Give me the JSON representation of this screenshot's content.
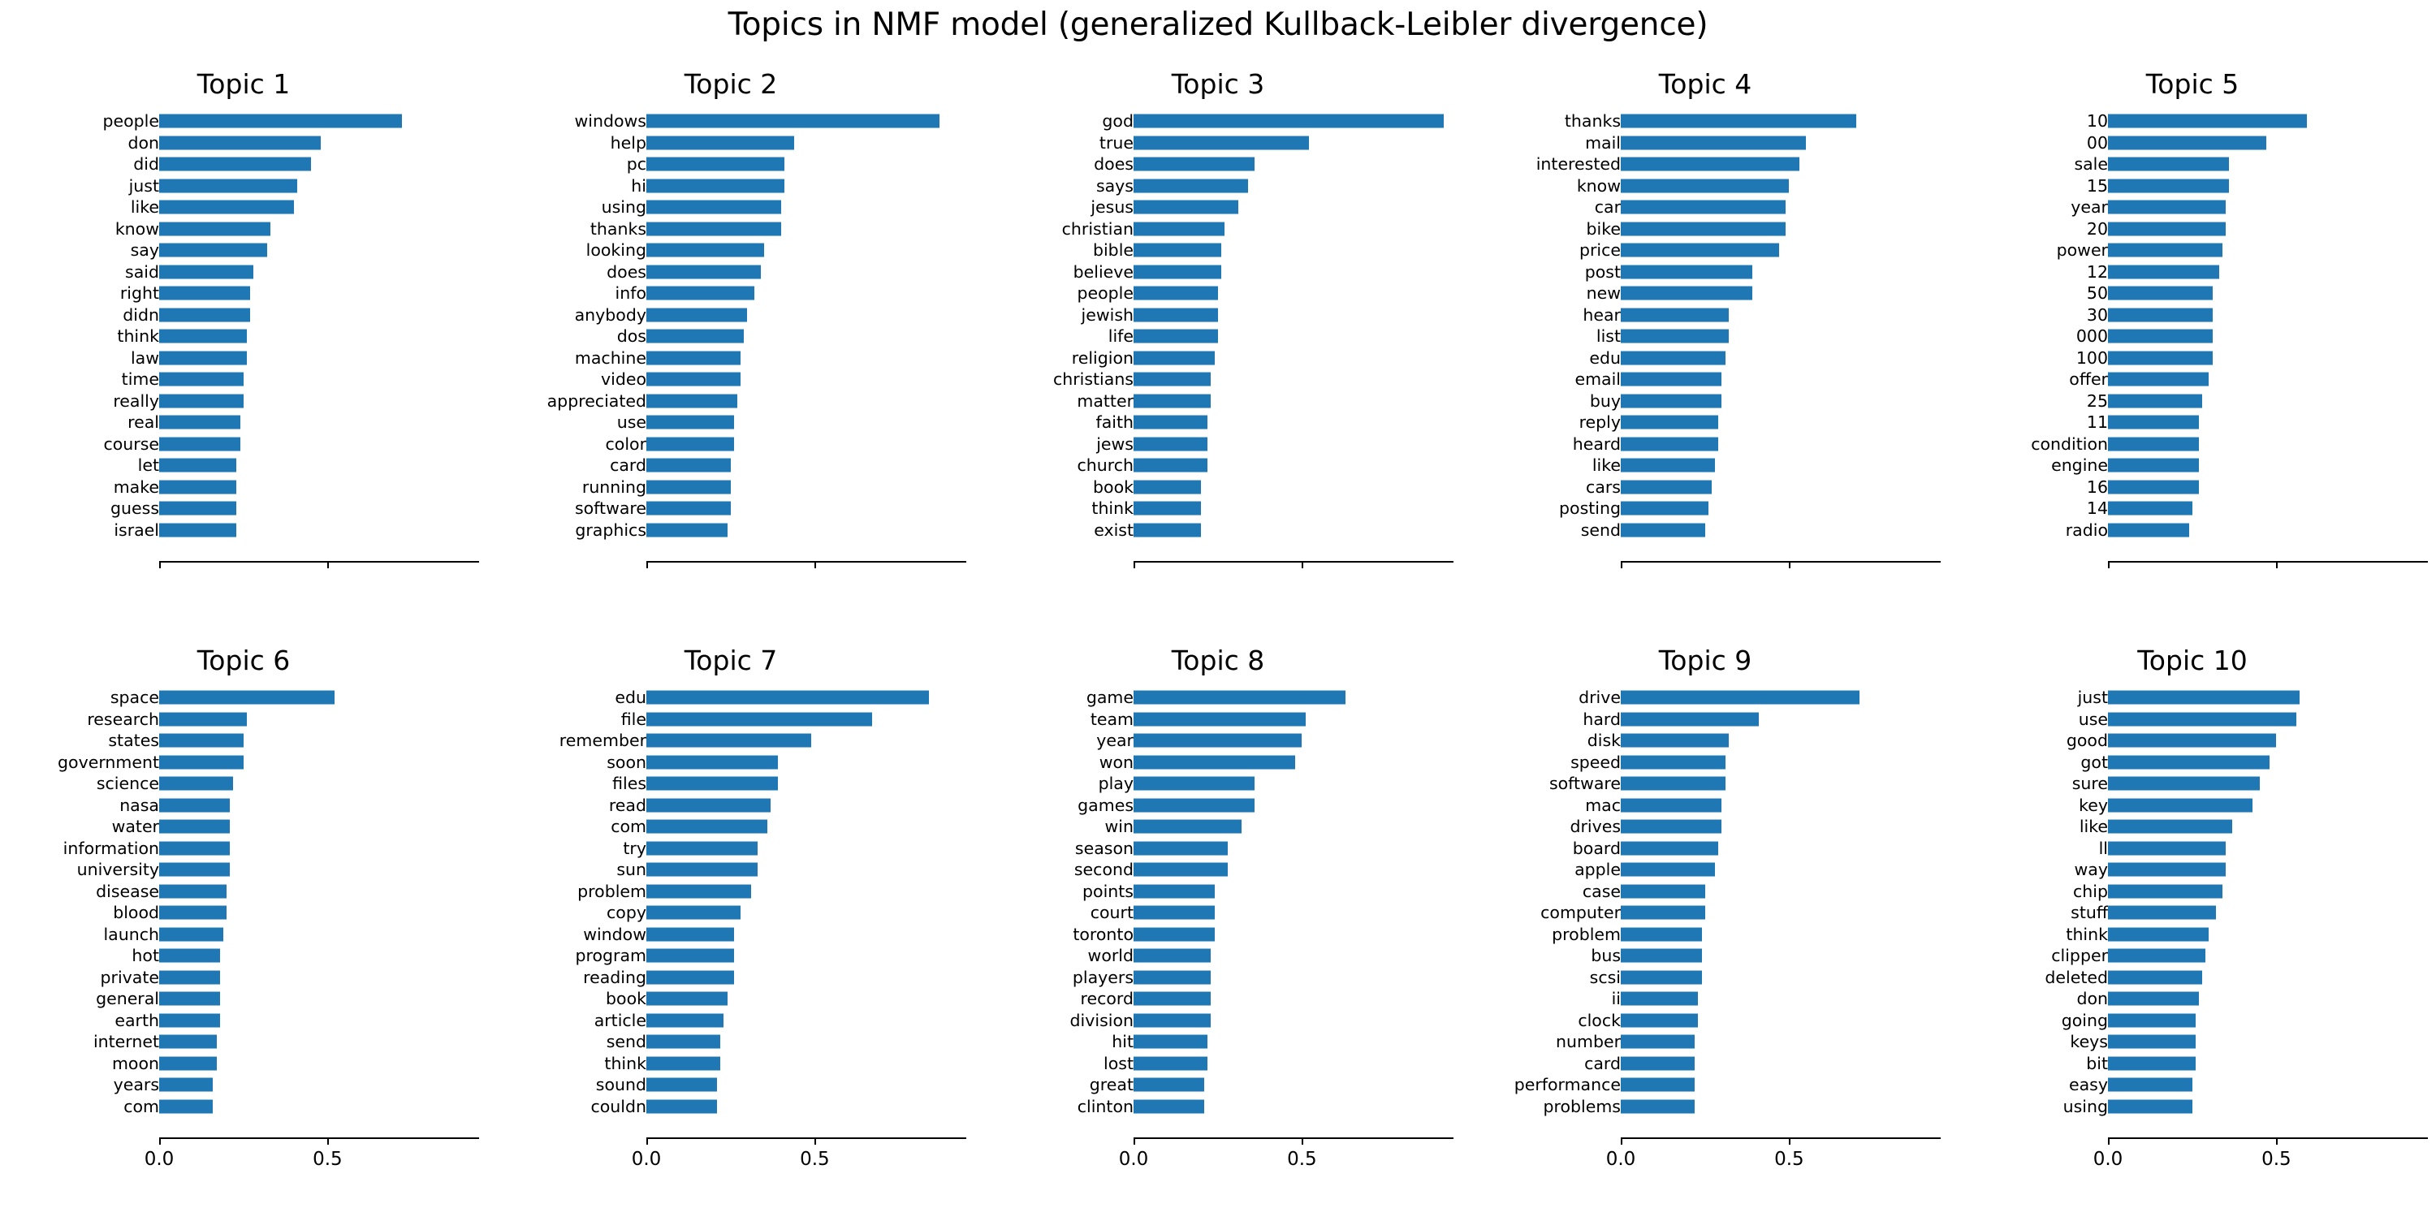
{
  "figure": {
    "suptitle": "Topics in NMF model (generalized Kullback-Leibler divergence)",
    "bar_color": "#1f77b4",
    "background": "#ffffff",
    "rows": 2,
    "cols": 5
  },
  "chart_data": {
    "type": "bar",
    "title": "Topics in NMF model (generalized Kullback-Leibler divergence)",
    "orientation": "horizontal",
    "xlabel": "",
    "ylabel": "",
    "xlim": [
      0.0,
      0.95
    ],
    "grid": false,
    "legend": null,
    "xticks": [
      0.0,
      0.5
    ],
    "xticklabels": [
      "0.0",
      "0.5"
    ],
    "xticklabels_shown_on": "bottom_row_only",
    "n_words_per_topic": 20,
    "panels": [
      {
        "title": "Topic 1",
        "categories": [
          "people",
          "don",
          "did",
          "just",
          "like",
          "know",
          "say",
          "said",
          "right",
          "didn",
          "think",
          "law",
          "time",
          "really",
          "real",
          "course",
          "let",
          "make",
          "guess",
          "israel"
        ],
        "values": [
          0.72,
          0.48,
          0.45,
          0.41,
          0.4,
          0.33,
          0.32,
          0.28,
          0.27,
          0.27,
          0.26,
          0.26,
          0.25,
          0.25,
          0.24,
          0.24,
          0.23,
          0.23,
          0.23,
          0.23
        ]
      },
      {
        "title": "Topic 2",
        "categories": [
          "windows",
          "help",
          "pc",
          "hi",
          "using",
          "thanks",
          "looking",
          "does",
          "info",
          "anybody",
          "dos",
          "machine",
          "video",
          "appreciated",
          "use",
          "color",
          "card",
          "running",
          "software",
          "graphics"
        ],
        "values": [
          0.87,
          0.44,
          0.41,
          0.41,
          0.4,
          0.4,
          0.35,
          0.34,
          0.32,
          0.3,
          0.29,
          0.28,
          0.28,
          0.27,
          0.26,
          0.26,
          0.25,
          0.25,
          0.25,
          0.24
        ]
      },
      {
        "title": "Topic 3",
        "categories": [
          "god",
          "true",
          "does",
          "says",
          "jesus",
          "christian",
          "bible",
          "believe",
          "people",
          "jewish",
          "life",
          "religion",
          "christians",
          "matter",
          "faith",
          "jews",
          "church",
          "book",
          "think",
          "exist"
        ],
        "values": [
          0.92,
          0.52,
          0.36,
          0.34,
          0.31,
          0.27,
          0.26,
          0.26,
          0.25,
          0.25,
          0.25,
          0.24,
          0.23,
          0.23,
          0.22,
          0.22,
          0.22,
          0.2,
          0.2,
          0.2
        ]
      },
      {
        "title": "Topic 4",
        "categories": [
          "thanks",
          "mail",
          "interested",
          "know",
          "car",
          "bike",
          "price",
          "post",
          "new",
          "hear",
          "list",
          "edu",
          "email",
          "buy",
          "reply",
          "heard",
          "like",
          "cars",
          "posting",
          "send"
        ],
        "values": [
          0.7,
          0.55,
          0.53,
          0.5,
          0.49,
          0.49,
          0.47,
          0.39,
          0.39,
          0.32,
          0.32,
          0.31,
          0.3,
          0.3,
          0.29,
          0.29,
          0.28,
          0.27,
          0.26,
          0.25
        ]
      },
      {
        "title": "Topic 5",
        "categories": [
          "10",
          "00",
          "sale",
          "15",
          "year",
          "20",
          "power",
          "12",
          "50",
          "30",
          "000",
          "100",
          "offer",
          "25",
          "11",
          "condition",
          "engine",
          "16",
          "14",
          "radio"
        ],
        "values": [
          0.59,
          0.47,
          0.36,
          0.36,
          0.35,
          0.35,
          0.34,
          0.33,
          0.31,
          0.31,
          0.31,
          0.31,
          0.3,
          0.28,
          0.27,
          0.27,
          0.27,
          0.27,
          0.25,
          0.24
        ]
      },
      {
        "title": "Topic 6",
        "categories": [
          "space",
          "research",
          "states",
          "government",
          "science",
          "nasa",
          "water",
          "information",
          "university",
          "disease",
          "blood",
          "launch",
          "hot",
          "private",
          "general",
          "earth",
          "internet",
          "moon",
          "years",
          "com"
        ],
        "values": [
          0.52,
          0.26,
          0.25,
          0.25,
          0.22,
          0.21,
          0.21,
          0.21,
          0.21,
          0.2,
          0.2,
          0.19,
          0.18,
          0.18,
          0.18,
          0.18,
          0.17,
          0.17,
          0.16,
          0.16
        ]
      },
      {
        "title": "Topic 7",
        "categories": [
          "edu",
          "file",
          "remember",
          "soon",
          "files",
          "read",
          "com",
          "try",
          "sun",
          "problem",
          "copy",
          "window",
          "program",
          "reading",
          "book",
          "article",
          "send",
          "think",
          "sound",
          "couldn"
        ],
        "values": [
          0.84,
          0.67,
          0.49,
          0.39,
          0.39,
          0.37,
          0.36,
          0.33,
          0.33,
          0.31,
          0.28,
          0.26,
          0.26,
          0.26,
          0.24,
          0.23,
          0.22,
          0.22,
          0.21,
          0.21
        ]
      },
      {
        "title": "Topic 8",
        "categories": [
          "game",
          "team",
          "year",
          "won",
          "play",
          "games",
          "win",
          "season",
          "second",
          "points",
          "court",
          "toronto",
          "world",
          "players",
          "record",
          "division",
          "hit",
          "lost",
          "great",
          "clinton"
        ],
        "values": [
          0.63,
          0.51,
          0.5,
          0.48,
          0.36,
          0.36,
          0.32,
          0.28,
          0.28,
          0.24,
          0.24,
          0.24,
          0.23,
          0.23,
          0.23,
          0.23,
          0.22,
          0.22,
          0.21,
          0.21
        ]
      },
      {
        "title": "Topic 9",
        "categories": [
          "drive",
          "hard",
          "disk",
          "speed",
          "software",
          "mac",
          "drives",
          "board",
          "apple",
          "case",
          "computer",
          "problem",
          "bus",
          "scsi",
          "ii",
          "clock",
          "number",
          "card",
          "performance",
          "problems"
        ],
        "values": [
          0.71,
          0.41,
          0.32,
          0.31,
          0.31,
          0.3,
          0.3,
          0.29,
          0.28,
          0.25,
          0.25,
          0.24,
          0.24,
          0.24,
          0.23,
          0.23,
          0.22,
          0.22,
          0.22,
          0.22
        ]
      },
      {
        "title": "Topic 10",
        "categories": [
          "just",
          "use",
          "good",
          "got",
          "sure",
          "key",
          "like",
          "ll",
          "way",
          "chip",
          "stuff",
          "think",
          "clipper",
          "deleted",
          "don",
          "going",
          "keys",
          "bit",
          "easy",
          "using"
        ],
        "values": [
          0.57,
          0.56,
          0.5,
          0.48,
          0.45,
          0.43,
          0.37,
          0.35,
          0.35,
          0.34,
          0.32,
          0.3,
          0.29,
          0.28,
          0.27,
          0.26,
          0.26,
          0.26,
          0.25,
          0.25
        ]
      }
    ]
  }
}
